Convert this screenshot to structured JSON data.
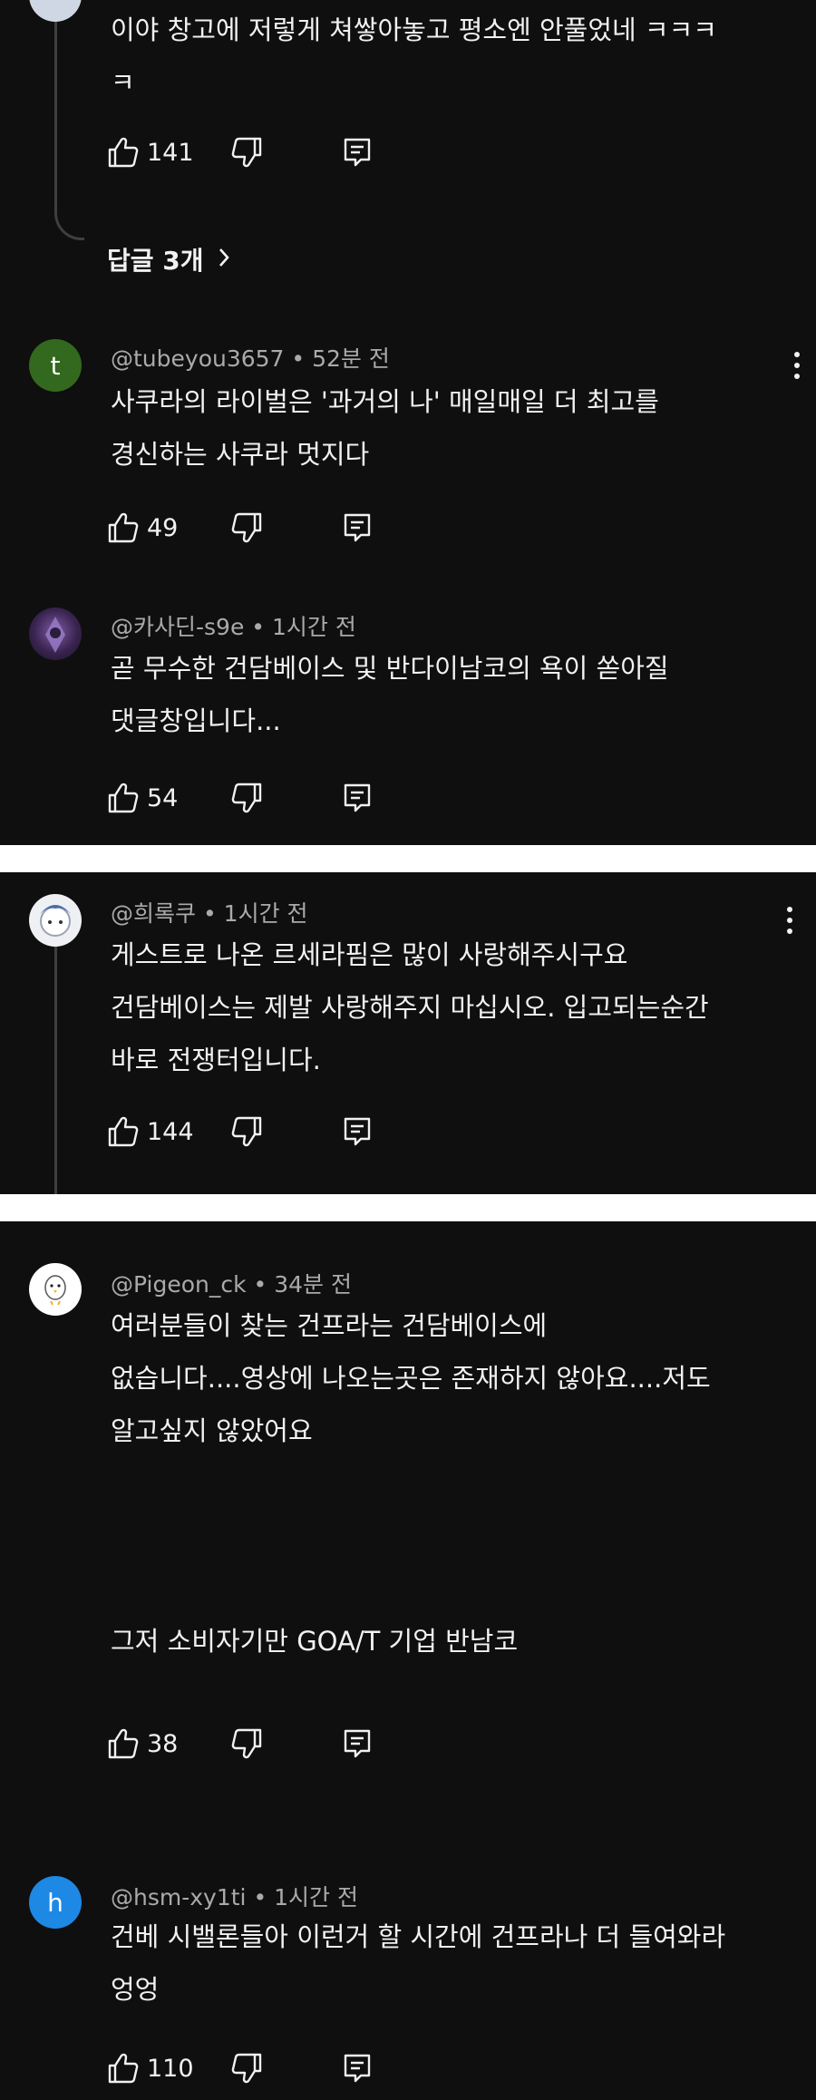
{
  "panels": [
    {
      "top_comment": {
        "text_lines": [
          "이야 창고에 저렇게 쳐쌓아놓고 평소엔 안풀었네 ㅋㅋㅋ",
          "ㅋ"
        ],
        "likes": "141",
        "replies_label": "답글 3개"
      },
      "comments": [
        {
          "avatar_letter": "t",
          "avatar_color": "#33691e",
          "author": "@tubeyou3657",
          "time": "52분 전",
          "text_lines": [
            "사쿠라의 라이벌은 '과거의 나' 매일매일 더 최고를",
            "경신하는 사쿠라 멋지다"
          ],
          "likes": "49"
        },
        {
          "avatar_letter": "",
          "avatar_color": "#3a2450",
          "author": "@카사딘-s9e",
          "time": "1시간 전",
          "text_lines": [
            "곧 무수한 건담베이스 및 반다이남코의 욕이 쏟아질",
            "댓글창입니다..."
          ],
          "likes": "54"
        }
      ]
    },
    {
      "comments": [
        {
          "avatar_letter": "",
          "avatar_color": "#d9dde6",
          "author": "@희록쿠",
          "time": "1시간 전",
          "text_lines": [
            "게스트로 나온 르세라핌은 많이 사랑해주시구요",
            "건담베이스는 제발 사랑해주지 마십시오. 입고되는순간",
            "바로 전쟁터입니다."
          ],
          "likes": "144"
        }
      ]
    },
    {
      "comments": [
        {
          "avatar_letter": "",
          "avatar_color": "#ffffff",
          "author": "@Pigeon_ck",
          "time": "34분 전",
          "text_lines": [
            "여러분들이 찾는 건프라는 건담베이스에",
            "없습니다....영상에 나오는곳은 존재하지 않아요....저도",
            "알고싶지 않았어요",
            "",
            "",
            "",
            "그저 소비자기만 GOA/T 기업 반남코"
          ],
          "likes": "38"
        },
        {
          "avatar_letter": "h",
          "avatar_color": "#1e88e5",
          "author": "@hsm-xy1ti",
          "time": "1시간 전",
          "text_lines": [
            "건베 시밸론들아 이런거 할 시간에 건프라나 더 들여와라",
            "엉엉"
          ],
          "likes": "110"
        }
      ]
    }
  ],
  "icons": [
    "like-icon",
    "dislike-icon",
    "reply-icon",
    "more-vert-icon",
    "chevron-right-icon"
  ]
}
